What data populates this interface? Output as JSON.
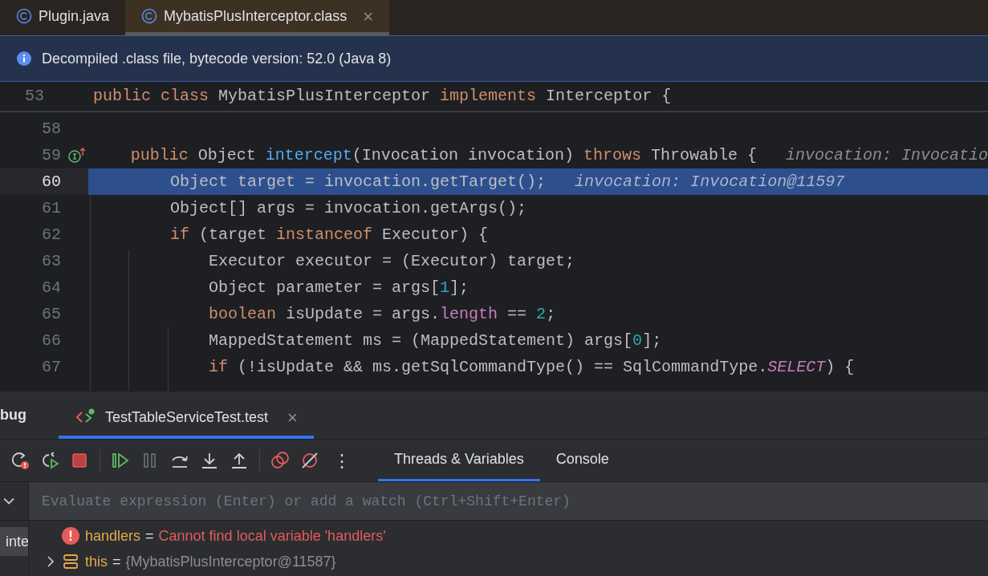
{
  "editor_tabs": [
    {
      "label": "Plugin.java",
      "selected": false,
      "closable": false
    },
    {
      "label": "MybatisPlusInterceptor.class",
      "selected": true,
      "closable": true,
      "close": "×"
    }
  ],
  "banner": {
    "text": "Decompiled .class file, bytecode version: 52.0 (Java 8)"
  },
  "editor": {
    "sticky_line": {
      "number": "53",
      "tokens": [
        {
          "text": "public ",
          "kind": "kw"
        },
        {
          "text": "class ",
          "kind": "kw"
        },
        {
          "text": "MybatisPlusInterceptor ",
          "kind": "plain"
        },
        {
          "text": "implements ",
          "kind": "kw"
        },
        {
          "text": "Interceptor {",
          "kind": "plain"
        }
      ]
    },
    "lines": [
      {
        "number": "58",
        "current": false,
        "marker": false
      },
      {
        "number": "59",
        "current": false,
        "marker": true,
        "tokens": [
          {
            "text": "    public ",
            "kind": "kw"
          },
          {
            "text": "Object ",
            "kind": "plain"
          },
          {
            "text": "intercept",
            "kind": "fn"
          },
          {
            "text": "(Invocation invocation) ",
            "kind": "plain"
          },
          {
            "text": "throws ",
            "kind": "kw"
          },
          {
            "text": "Throwable {",
            "kind": "plain"
          },
          {
            "text": "   invocation: Invocatio",
            "kind": "hint"
          }
        ]
      },
      {
        "number": "60",
        "current": true,
        "marker": false,
        "tokens": [
          {
            "text": "        Object target = invocation.getTarget();",
            "kind": "plain"
          },
          {
            "text": "   invocation: Invocation@11597",
            "kind": "hint"
          }
        ]
      },
      {
        "number": "61",
        "current": false,
        "marker": false,
        "tokens": [
          {
            "text": "        Object[] args = invocation.getArgs();",
            "kind": "plain"
          }
        ]
      },
      {
        "number": "62",
        "current": false,
        "marker": false,
        "tokens": [
          {
            "text": "        if ",
            "kind": "kw"
          },
          {
            "text": "(target ",
            "kind": "plain"
          },
          {
            "text": "instanceof ",
            "kind": "kw"
          },
          {
            "text": "Executor) {",
            "kind": "plain"
          }
        ]
      },
      {
        "number": "63",
        "current": false,
        "marker": false,
        "tokens": [
          {
            "text": "            Executor executor = (Executor) target;",
            "kind": "plain"
          }
        ]
      },
      {
        "number": "64",
        "current": false,
        "marker": false,
        "tokens": [
          {
            "text": "            Object parameter = args[",
            "kind": "plain"
          },
          {
            "text": "1",
            "kind": "num"
          },
          {
            "text": "];",
            "kind": "plain"
          }
        ]
      },
      {
        "number": "65",
        "current": false,
        "marker": false,
        "tokens": [
          {
            "text": "            boolean ",
            "kind": "kw"
          },
          {
            "text": "isUpdate = args.",
            "kind": "plain"
          },
          {
            "text": "length",
            "kind": "field"
          },
          {
            "text": " == ",
            "kind": "plain"
          },
          {
            "text": "2",
            "kind": "num"
          },
          {
            "text": ";",
            "kind": "plain"
          }
        ]
      },
      {
        "number": "66",
        "current": false,
        "marker": false,
        "tokens": [
          {
            "text": "            MappedStatement ms = (MappedStatement) args[",
            "kind": "plain"
          },
          {
            "text": "0",
            "kind": "num"
          },
          {
            "text": "];",
            "kind": "plain"
          }
        ]
      },
      {
        "number": "67",
        "current": false,
        "marker": false,
        "tokens": [
          {
            "text": "            if ",
            "kind": "kw"
          },
          {
            "text": "(!isUpdate && ms.getSqlCommandType() == SqlCommandType.",
            "kind": "plain"
          },
          {
            "text": "SELECT",
            "kind": "static"
          },
          {
            "text": ") {",
            "kind": "plain"
          }
        ]
      }
    ]
  },
  "debug": {
    "title": "bug",
    "session_tab": {
      "label": "TestTableServiceTest.test",
      "selected": true,
      "close": "×"
    },
    "toolbar": [
      {
        "kind": "rerun"
      },
      {
        "kind": "rerun-failed"
      },
      {
        "kind": "stop"
      },
      {
        "kind": "sep"
      },
      {
        "kind": "resume"
      },
      {
        "kind": "pause"
      },
      {
        "kind": "step-over"
      },
      {
        "kind": "step-into"
      },
      {
        "kind": "step-out"
      },
      {
        "kind": "sep"
      },
      {
        "kind": "breakpoints"
      },
      {
        "kind": "mute"
      },
      {
        "kind": "more",
        "text": "⋮"
      }
    ],
    "tabs": [
      {
        "label": "Threads & Variables",
        "selected": true
      },
      {
        "label": "Console",
        "selected": false
      }
    ],
    "frames": [
      {
        "label": "inte",
        "selected": true
      }
    ],
    "evaluate": {
      "placeholder": "Evaluate expression (Enter) or add a watch (Ctrl+Shift+Enter)"
    },
    "variables": [
      {
        "kind": "error",
        "name": "handlers",
        "eq": "=",
        "value": "Cannot find local variable 'handlers'",
        "expandable": false
      },
      {
        "kind": "field",
        "name": "this",
        "eq": "=",
        "value": "{MybatisPlusInterceptor@11587}",
        "expandable": true
      }
    ]
  }
}
